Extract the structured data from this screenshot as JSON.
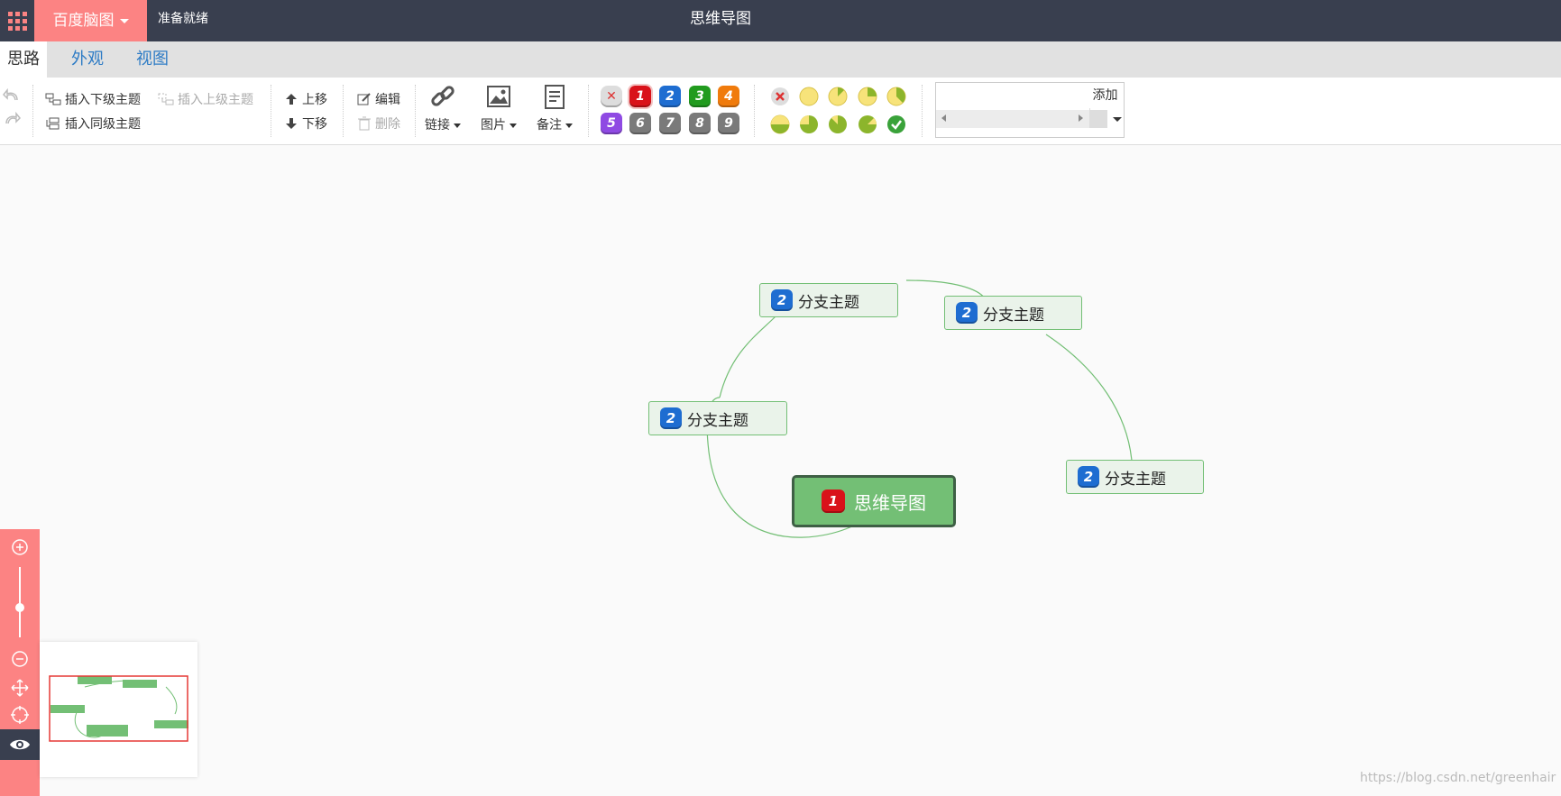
{
  "topbar": {
    "brand": "百度脑图",
    "status": "准备就绪",
    "title": "思维导图"
  },
  "tabs": [
    {
      "label": "思路",
      "active": true
    },
    {
      "label": "外观",
      "active": false
    },
    {
      "label": "视图",
      "active": false
    }
  ],
  "toolbar": {
    "insert_child": "插入下级主题",
    "insert_parent": "插入上级主题",
    "insert_sibling": "插入同级主题",
    "move_up": "上移",
    "move_down": "下移",
    "edit": "编辑",
    "delete": "删除",
    "link": "链接",
    "image": "图片",
    "note": "备注",
    "priorities": [
      "1",
      "2",
      "3",
      "4",
      "5",
      "6",
      "7",
      "8",
      "9"
    ],
    "resource_add": "添加",
    "resource_placeholder": ""
  },
  "mindmap": {
    "root": {
      "label": "思维导图",
      "priority": "1"
    },
    "branches": [
      {
        "label": "分支主题",
        "priority": "2"
      },
      {
        "label": "分支主题",
        "priority": "2"
      },
      {
        "label": "分支主题",
        "priority": "2"
      },
      {
        "label": "分支主题",
        "priority": "2"
      }
    ]
  },
  "colors": {
    "topbar": "#393f4f",
    "accent": "#fc8383",
    "node_fill": "#73bf75",
    "node_border": "#3e5f45"
  },
  "watermark": "https://blog.csdn.net/greenhair"
}
